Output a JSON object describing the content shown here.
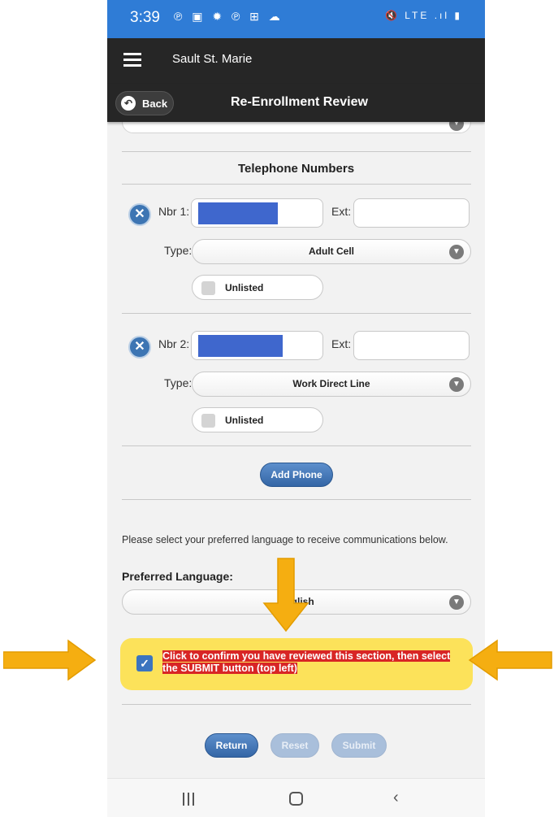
{
  "status_bar": {
    "time": "3:39",
    "left_icons": "℗ ▣ ✹ ℗ ⊞ ☁",
    "right_icons": "🔇 LTE .ıl ▮"
  },
  "app_bar": {
    "title": "Sault St. Marie"
  },
  "header": {
    "back_label": "Back",
    "title": "Re-Enrollment Review"
  },
  "phones": {
    "section_title": "Telephone Numbers",
    "entries": [
      {
        "number_label": "Nbr 1:",
        "ext_label": "Ext:",
        "type_label": "Type:",
        "type_value": "Adult Cell",
        "unlisted_label": "Unlisted"
      },
      {
        "number_label": "Nbr 2:",
        "ext_label": "Ext:",
        "type_label": "Type:",
        "type_value": "Work Direct Line",
        "unlisted_label": "Unlisted"
      }
    ],
    "add_phone_label": "Add Phone"
  },
  "language": {
    "info_text": "Please select your preferred language to receive communications below.",
    "label": "Preferred Language:",
    "value": "English"
  },
  "confirm": {
    "text": "Click to confirm you have reviewed this section, then select the SUBMIT button (top left)",
    "checked": true
  },
  "actions": {
    "return_label": "Return",
    "reset_label": "Reset",
    "submit_label": "Submit"
  },
  "colors": {
    "status_bar": "#2f7cd6",
    "app_bar": "#262626",
    "button_blue": "#3466a6",
    "highlight_yellow": "#fce25a",
    "arrow_orange": "#f5ae11",
    "alert_red": "#d82525"
  }
}
